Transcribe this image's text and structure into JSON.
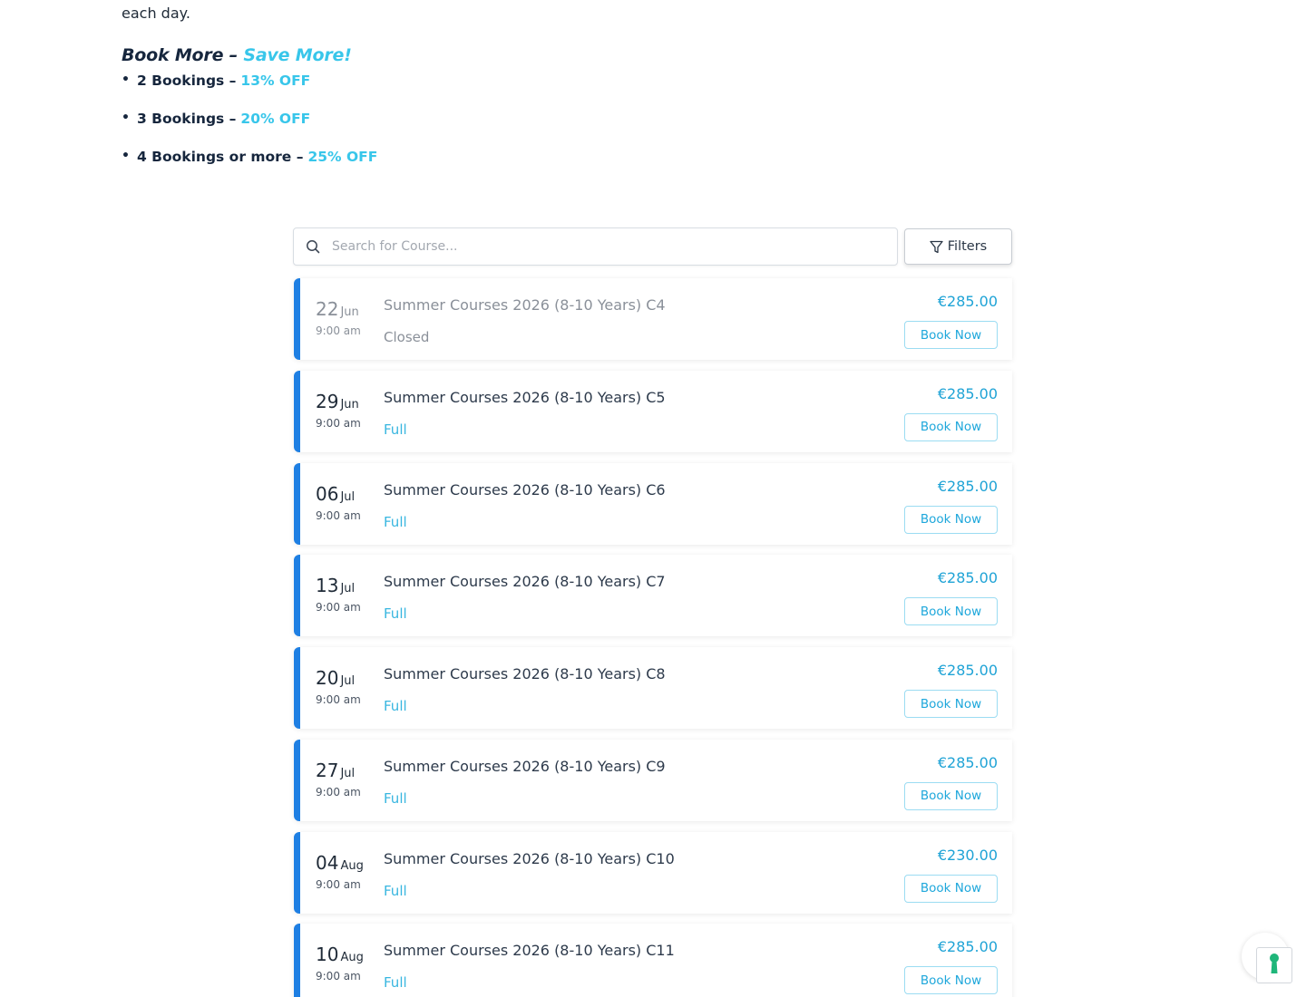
{
  "intro": {
    "tail_text": "each day."
  },
  "promo": {
    "heading_main": "Book More – ",
    "heading_accent": "Save More!",
    "items": [
      {
        "label": "2 Bookings – ",
        "discount": "13% OFF"
      },
      {
        "label": "3 Bookings – ",
        "discount": "20% OFF"
      },
      {
        "label": "4 Bookings or more – ",
        "discount": "25% OFF"
      }
    ]
  },
  "search": {
    "placeholder": "Search for Course..."
  },
  "filters": {
    "label": "Filters"
  },
  "courses": [
    {
      "day": "22",
      "month": "Jun",
      "time": "9:00 am",
      "title": "Summer Courses 2026 (8-10 Years) C4",
      "status": "Closed",
      "price": "€285.00",
      "button": "Book Now"
    },
    {
      "day": "29",
      "month": "Jun",
      "time": "9:00 am",
      "title": "Summer Courses 2026 (8-10 Years) C5",
      "status": "Full",
      "price": "€285.00",
      "button": "Book Now"
    },
    {
      "day": "06",
      "month": "Jul",
      "time": "9:00 am",
      "title": "Summer Courses 2026 (8-10 Years) C6",
      "status": "Full",
      "price": "€285.00",
      "button": "Book Now"
    },
    {
      "day": "13",
      "month": "Jul",
      "time": "9:00 am",
      "title": "Summer Courses 2026 (8-10 Years) C7",
      "status": "Full",
      "price": "€285.00",
      "button": "Book Now"
    },
    {
      "day": "20",
      "month": "Jul",
      "time": "9:00 am",
      "title": "Summer Courses 2026 (8-10 Years) C8",
      "status": "Full",
      "price": "€285.00",
      "button": "Book Now"
    },
    {
      "day": "27",
      "month": "Jul",
      "time": "9:00 am",
      "title": "Summer Courses 2026 (8-10 Years) C9",
      "status": "Full",
      "price": "€285.00",
      "button": "Book Now"
    },
    {
      "day": "04",
      "month": "Aug",
      "time": "9:00 am",
      "title": "Summer Courses 2026 (8-10 Years) C10",
      "status": "Full",
      "price": "€230.00",
      "button": "Book Now"
    },
    {
      "day": "10",
      "month": "Aug",
      "time": "9:00 am",
      "title": "Summer Courses 2026 (8-10 Years) C11",
      "status": "Full",
      "price": "€285.00",
      "button": "Book Now"
    }
  ],
  "colors": {
    "accent": "#38c6ea",
    "card_border": "#1e7fe3",
    "price": "#1fa3d6",
    "heading": "#16263d"
  }
}
